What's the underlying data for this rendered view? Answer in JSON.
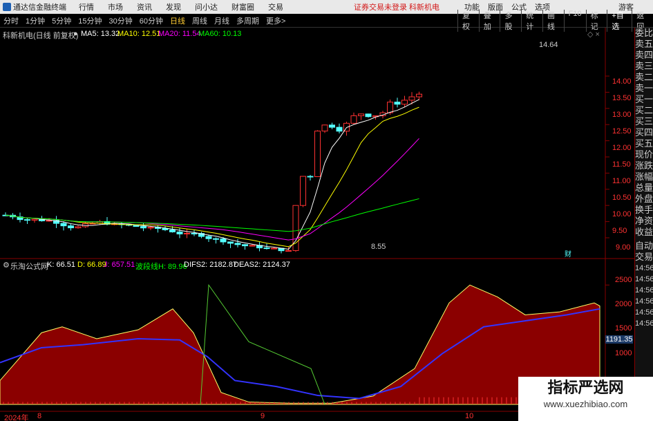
{
  "app": {
    "title": "通达信金融终端"
  },
  "menu": [
    "行情",
    "市场",
    "资讯",
    "发现",
    "问小达",
    "财富圈",
    "交易"
  ],
  "warning": "证券交易未登录  科新机电",
  "right_menu": [
    "功能",
    "版面",
    "公式",
    "选项"
  ],
  "guest": "游客",
  "timeframes": [
    "分时",
    "1分钟",
    "5分钟",
    "15分钟",
    "30分钟",
    "60分钟",
    "日线",
    "周线",
    "月线",
    "多周期",
    "更多>"
  ],
  "active_timeframe": "日线",
  "toolbar": [
    "复权",
    "叠加",
    "多股",
    "统计",
    "画线",
    "F10",
    "标记",
    "+自选",
    "返回"
  ],
  "sidebar": [
    "委比",
    "卖五",
    "卖四",
    "卖三",
    "卖二",
    "卖一",
    "买一",
    "买二",
    "买三",
    "买四",
    "买五",
    "现价",
    "涨跌",
    "涨幅",
    "总量",
    "外盘",
    "换手",
    "净资",
    "收益"
  ],
  "sidebar2": [
    "自动",
    "交易",
    "14:56",
    "14:56",
    "14:56",
    "14:56",
    "14:56",
    "14:56",
    "14:56",
    "14:56",
    "14:56"
  ],
  "main_chart": {
    "stock": "科新机电(日线 前复权)",
    "ma5": "MA5: 13.32",
    "ma10": "MA10: 12.51",
    "ma20": "MA20: 11.54",
    "ma60": "MA60: 10.13",
    "high_label": "14.64",
    "low_label": "8.55",
    "cai_label": "财",
    "y_ticks": [
      "14.00",
      "13.50",
      "13.00",
      "12.50",
      "12.00",
      "11.50",
      "11.00",
      "10.50",
      "10.00",
      "9.50",
      "9.00"
    ]
  },
  "sub_chart": {
    "name": "乐淘公式网",
    "k": "K: 66.51",
    "d": "D: 66.89",
    "j": "J: 657.51",
    "wave": "波段线H: 89.96",
    "difs": "DIFS2: 2182.87",
    "deas": "DEAS2: 2124.37",
    "y_ticks": [
      "2500",
      "2000",
      "1500",
      "1000"
    ],
    "current": "1191.35"
  },
  "x_axis": {
    "year": "2024年",
    "m8": "8",
    "m9": "9",
    "m10": "10"
  },
  "watermark": {
    "title": "指标严选网",
    "url": "www.xuezhibiao.com"
  },
  "colors": {
    "up": "#ff3232",
    "down": "#54ffff",
    "ma5": "#ffffff",
    "ma10": "#ffff00",
    "ma20": "#ff00ff",
    "ma60": "#00ff00",
    "area": "#8b0000"
  }
}
